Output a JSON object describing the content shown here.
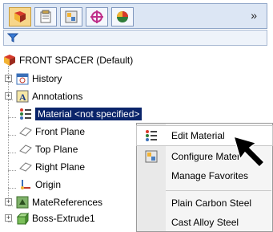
{
  "toolbar": {
    "buttons": [
      {
        "name": "feature-manager-icon"
      },
      {
        "name": "property-manager-icon"
      },
      {
        "name": "configuration-manager-icon"
      },
      {
        "name": "dimxpert-icon"
      },
      {
        "name": "display-manager-icon"
      }
    ],
    "more_label": "»"
  },
  "tree": {
    "root_label": "FRONT SPACER  (Default)",
    "items": [
      {
        "label": "History"
      },
      {
        "label": "Annotations"
      },
      {
        "label": "Material <not specified>"
      },
      {
        "label": "Front Plane"
      },
      {
        "label": "Top Plane"
      },
      {
        "label": "Right Plane"
      },
      {
        "label": "Origin"
      },
      {
        "label": "MateReferences"
      },
      {
        "label": "Boss-Extrude1"
      }
    ]
  },
  "context_menu": {
    "items": [
      {
        "label": "Edit Material"
      },
      {
        "label": "Configure Mater"
      },
      {
        "label": "Manage Favorites"
      },
      {
        "label": "Plain Carbon Steel"
      },
      {
        "label": "Cast Alloy Steel"
      }
    ]
  },
  "colors": {
    "selection": "#0a246a",
    "toolbar_bg": "#dce6f4",
    "menu_bg": "#f5f5f5"
  }
}
